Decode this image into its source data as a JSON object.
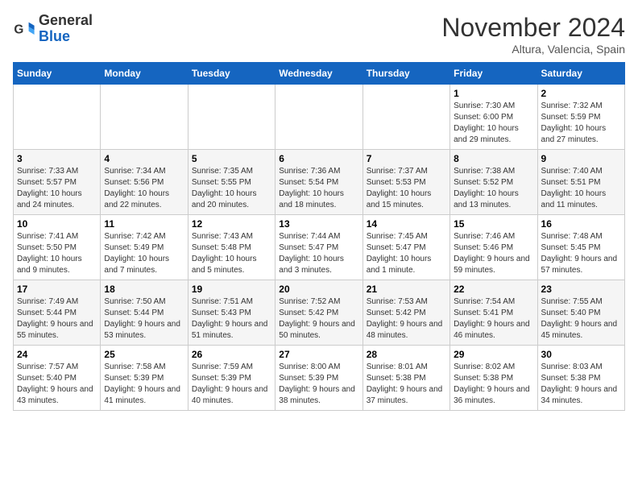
{
  "header": {
    "logo_general": "General",
    "logo_blue": "Blue",
    "month": "November 2024",
    "location": "Altura, Valencia, Spain"
  },
  "weekdays": [
    "Sunday",
    "Monday",
    "Tuesday",
    "Wednesday",
    "Thursday",
    "Friday",
    "Saturday"
  ],
  "weeks": [
    [
      {
        "day": "",
        "info": ""
      },
      {
        "day": "",
        "info": ""
      },
      {
        "day": "",
        "info": ""
      },
      {
        "day": "",
        "info": ""
      },
      {
        "day": "",
        "info": ""
      },
      {
        "day": "1",
        "info": "Sunrise: 7:30 AM\nSunset: 6:00 PM\nDaylight: 10 hours and 29 minutes."
      },
      {
        "day": "2",
        "info": "Sunrise: 7:32 AM\nSunset: 5:59 PM\nDaylight: 10 hours and 27 minutes."
      }
    ],
    [
      {
        "day": "3",
        "info": "Sunrise: 7:33 AM\nSunset: 5:57 PM\nDaylight: 10 hours and 24 minutes."
      },
      {
        "day": "4",
        "info": "Sunrise: 7:34 AM\nSunset: 5:56 PM\nDaylight: 10 hours and 22 minutes."
      },
      {
        "day": "5",
        "info": "Sunrise: 7:35 AM\nSunset: 5:55 PM\nDaylight: 10 hours and 20 minutes."
      },
      {
        "day": "6",
        "info": "Sunrise: 7:36 AM\nSunset: 5:54 PM\nDaylight: 10 hours and 18 minutes."
      },
      {
        "day": "7",
        "info": "Sunrise: 7:37 AM\nSunset: 5:53 PM\nDaylight: 10 hours and 15 minutes."
      },
      {
        "day": "8",
        "info": "Sunrise: 7:38 AM\nSunset: 5:52 PM\nDaylight: 10 hours and 13 minutes."
      },
      {
        "day": "9",
        "info": "Sunrise: 7:40 AM\nSunset: 5:51 PM\nDaylight: 10 hours and 11 minutes."
      }
    ],
    [
      {
        "day": "10",
        "info": "Sunrise: 7:41 AM\nSunset: 5:50 PM\nDaylight: 10 hours and 9 minutes."
      },
      {
        "day": "11",
        "info": "Sunrise: 7:42 AM\nSunset: 5:49 PM\nDaylight: 10 hours and 7 minutes."
      },
      {
        "day": "12",
        "info": "Sunrise: 7:43 AM\nSunset: 5:48 PM\nDaylight: 10 hours and 5 minutes."
      },
      {
        "day": "13",
        "info": "Sunrise: 7:44 AM\nSunset: 5:47 PM\nDaylight: 10 hours and 3 minutes."
      },
      {
        "day": "14",
        "info": "Sunrise: 7:45 AM\nSunset: 5:47 PM\nDaylight: 10 hours and 1 minute."
      },
      {
        "day": "15",
        "info": "Sunrise: 7:46 AM\nSunset: 5:46 PM\nDaylight: 9 hours and 59 minutes."
      },
      {
        "day": "16",
        "info": "Sunrise: 7:48 AM\nSunset: 5:45 PM\nDaylight: 9 hours and 57 minutes."
      }
    ],
    [
      {
        "day": "17",
        "info": "Sunrise: 7:49 AM\nSunset: 5:44 PM\nDaylight: 9 hours and 55 minutes."
      },
      {
        "day": "18",
        "info": "Sunrise: 7:50 AM\nSunset: 5:44 PM\nDaylight: 9 hours and 53 minutes."
      },
      {
        "day": "19",
        "info": "Sunrise: 7:51 AM\nSunset: 5:43 PM\nDaylight: 9 hours and 51 minutes."
      },
      {
        "day": "20",
        "info": "Sunrise: 7:52 AM\nSunset: 5:42 PM\nDaylight: 9 hours and 50 minutes."
      },
      {
        "day": "21",
        "info": "Sunrise: 7:53 AM\nSunset: 5:42 PM\nDaylight: 9 hours and 48 minutes."
      },
      {
        "day": "22",
        "info": "Sunrise: 7:54 AM\nSunset: 5:41 PM\nDaylight: 9 hours and 46 minutes."
      },
      {
        "day": "23",
        "info": "Sunrise: 7:55 AM\nSunset: 5:40 PM\nDaylight: 9 hours and 45 minutes."
      }
    ],
    [
      {
        "day": "24",
        "info": "Sunrise: 7:57 AM\nSunset: 5:40 PM\nDaylight: 9 hours and 43 minutes."
      },
      {
        "day": "25",
        "info": "Sunrise: 7:58 AM\nSunset: 5:39 PM\nDaylight: 9 hours and 41 minutes."
      },
      {
        "day": "26",
        "info": "Sunrise: 7:59 AM\nSunset: 5:39 PM\nDaylight: 9 hours and 40 minutes."
      },
      {
        "day": "27",
        "info": "Sunrise: 8:00 AM\nSunset: 5:39 PM\nDaylight: 9 hours and 38 minutes."
      },
      {
        "day": "28",
        "info": "Sunrise: 8:01 AM\nSunset: 5:38 PM\nDaylight: 9 hours and 37 minutes."
      },
      {
        "day": "29",
        "info": "Sunrise: 8:02 AM\nSunset: 5:38 PM\nDaylight: 9 hours and 36 minutes."
      },
      {
        "day": "30",
        "info": "Sunrise: 8:03 AM\nSunset: 5:38 PM\nDaylight: 9 hours and 34 minutes."
      }
    ]
  ]
}
